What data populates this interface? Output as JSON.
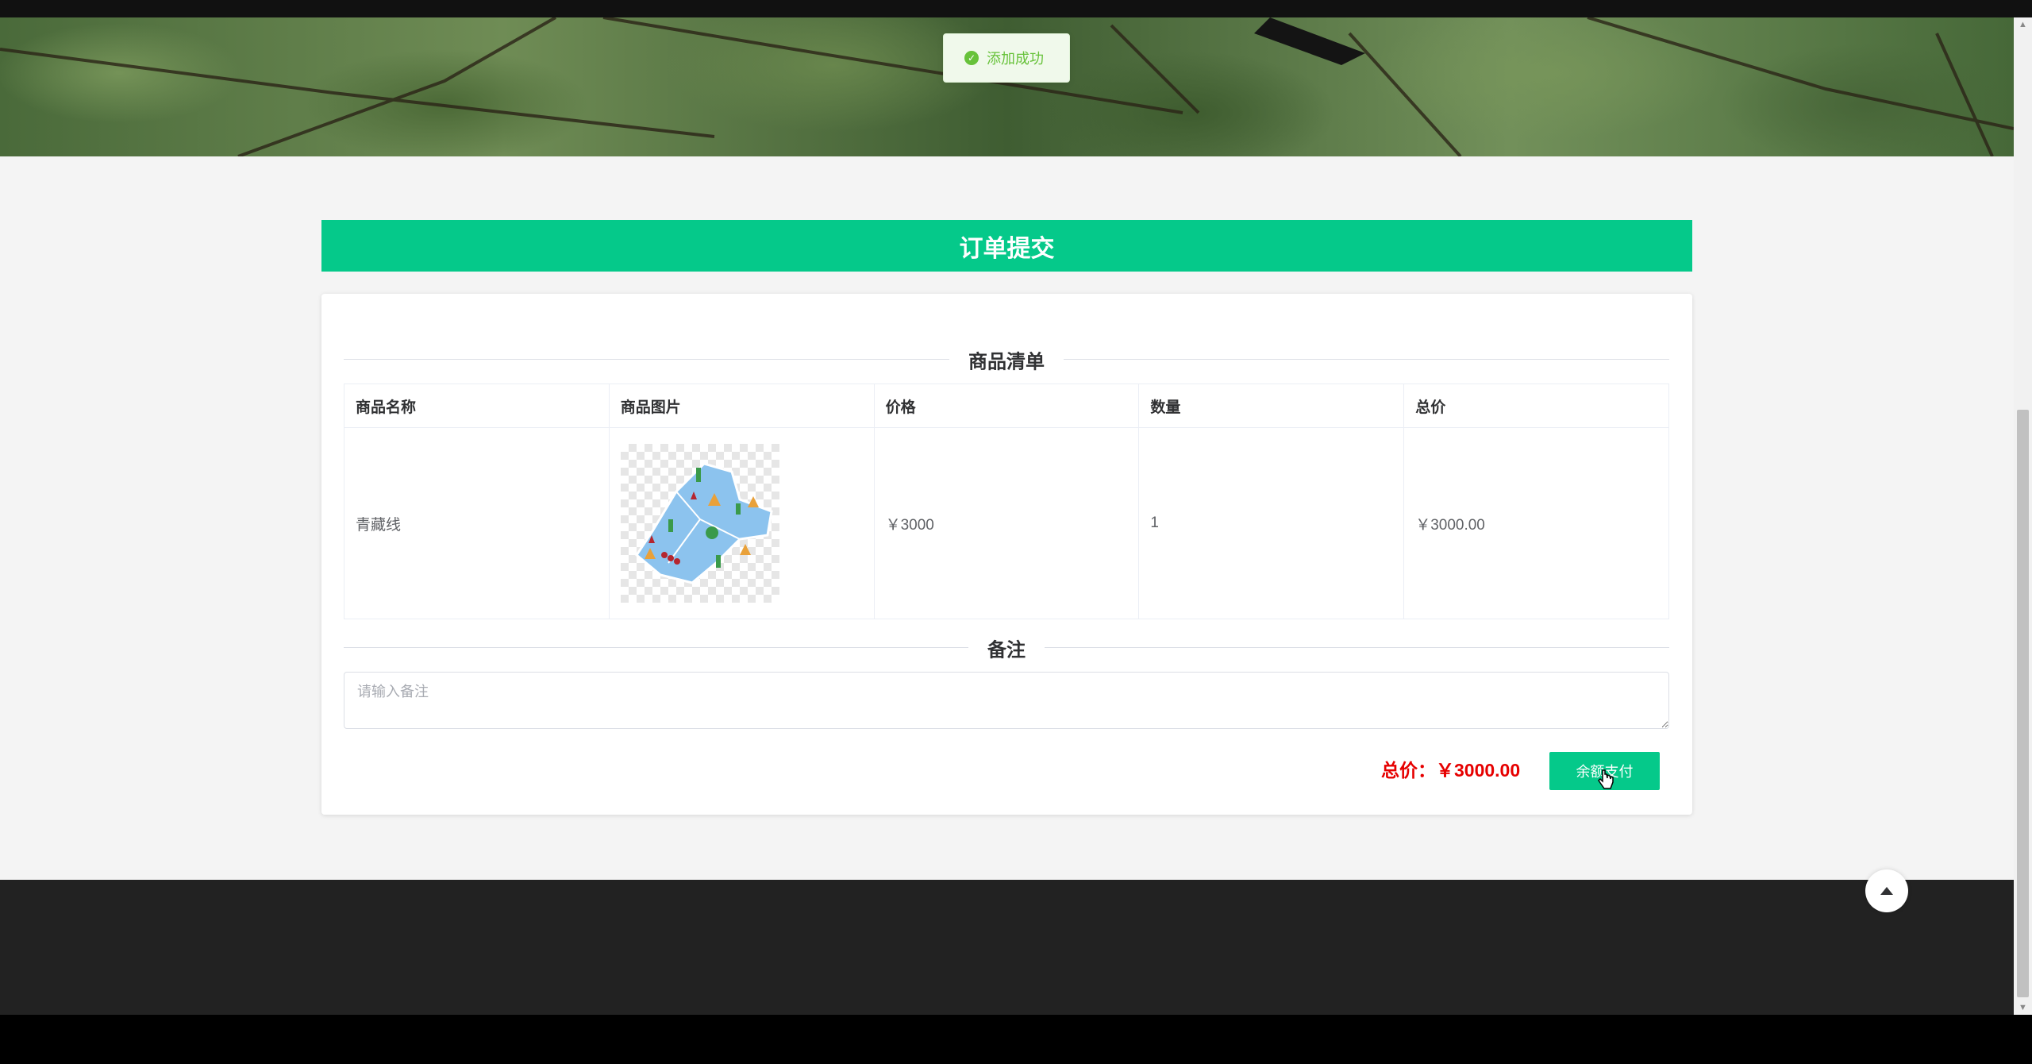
{
  "toast": {
    "message": "添加成功",
    "icon": "check-circle-icon",
    "color": "#67c23a"
  },
  "page": {
    "title": "订单提交",
    "accent": "#05c98a"
  },
  "order": {
    "section_title": "商品清单",
    "columns": [
      "商品名称",
      "商品图片",
      "价格",
      "数量",
      "总价"
    ],
    "rows": [
      {
        "name": "青藏线",
        "image": "map-thumbnail",
        "price": "￥3000",
        "quantity": "1",
        "total": "￥3000.00"
      }
    ]
  },
  "remark": {
    "section_title": "备注",
    "placeholder": "请输入备注",
    "value": ""
  },
  "summary": {
    "total_label": "总价：",
    "total_value": "￥3000.00",
    "total_color": "#e60000",
    "pay_label": "余额支付"
  },
  "back_to_top": {
    "icon": "caret-up-icon"
  }
}
